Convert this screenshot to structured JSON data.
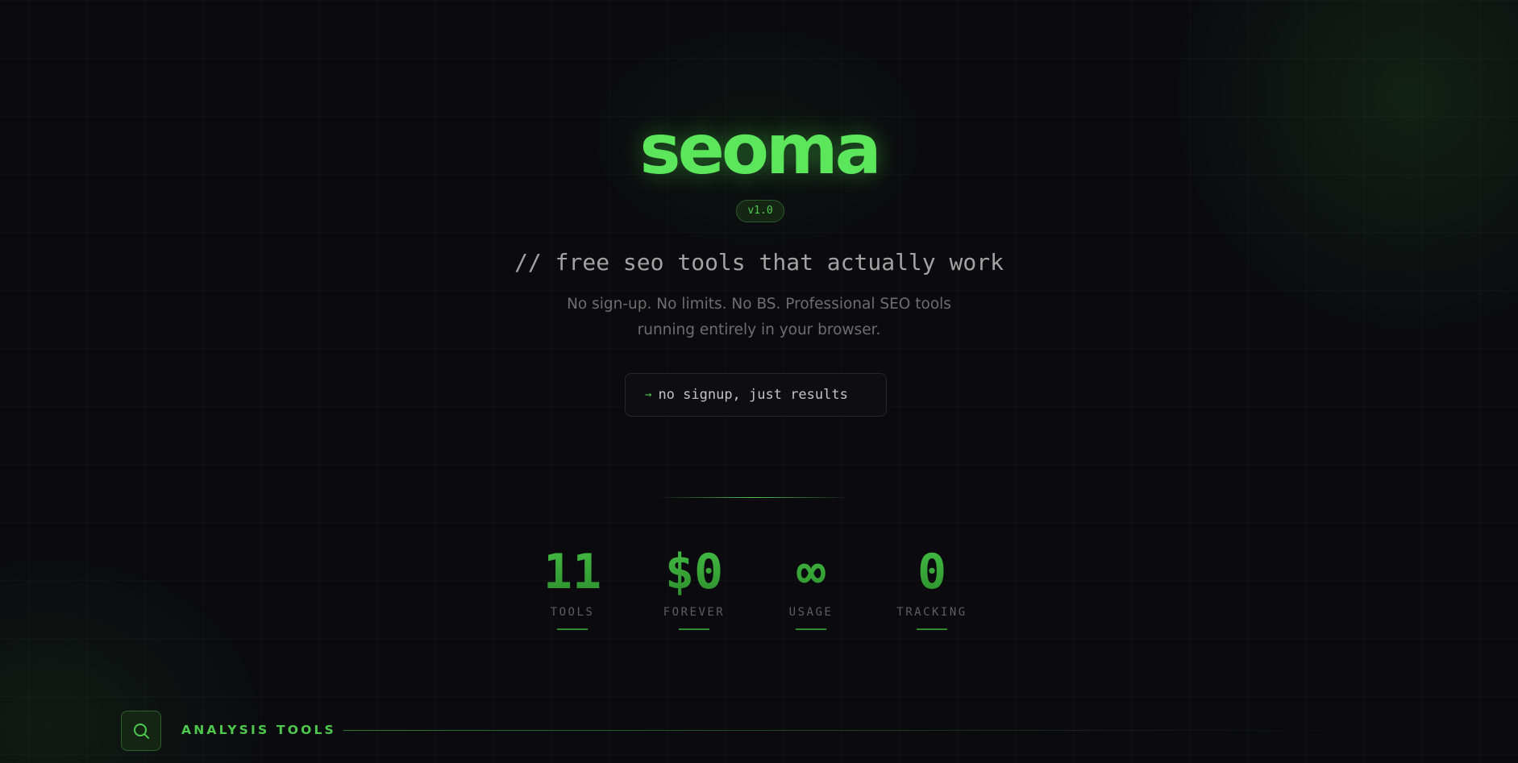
{
  "brand": {
    "logo": "seoma",
    "version": "v1.0"
  },
  "hero": {
    "tagline": "// free seo tools that actually work",
    "description_line1": "No sign-up. No limits. No BS. Professional SEO tools",
    "description_line2": "running entirely in your browser.",
    "cta_arrow": "→",
    "cta_label": "no signup, just results"
  },
  "stats": [
    {
      "value": "11",
      "label": "TOOLS"
    },
    {
      "value": "$0",
      "label": "FOREVER"
    },
    {
      "value": "∞",
      "label": "USAGE"
    },
    {
      "value": "0",
      "label": "TRACKING"
    }
  ],
  "section": {
    "icon": "search-icon",
    "title": "ANALYSIS TOOLS"
  },
  "colors": {
    "accent": "#5ce65c",
    "accent_dark": "#3fb23f",
    "background": "#0b0b0f"
  }
}
